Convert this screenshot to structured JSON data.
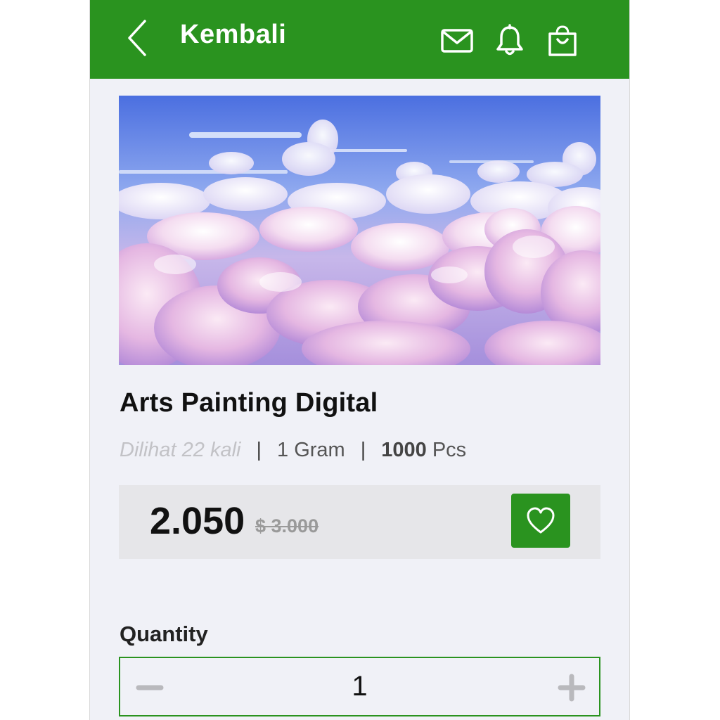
{
  "header": {
    "back_label": "Kembali",
    "icons": [
      "back-chevron-icon",
      "mail-icon",
      "bell-icon",
      "shopping-bag-icon"
    ]
  },
  "product": {
    "image": "clouds-sky-painting",
    "title": "Arts Painting Digital",
    "views": "Dilihat 22 kali",
    "weight": "1 Gram",
    "stock_count": "1000",
    "stock_unit": "Pcs",
    "price": "2.050",
    "old_price": "$ 3.000"
  },
  "quantity": {
    "label": "Quantity",
    "value": "1"
  },
  "colors": {
    "primary": "#2a931f",
    "background": "#f0f1f7",
    "price_box": "#e6e6e9"
  }
}
